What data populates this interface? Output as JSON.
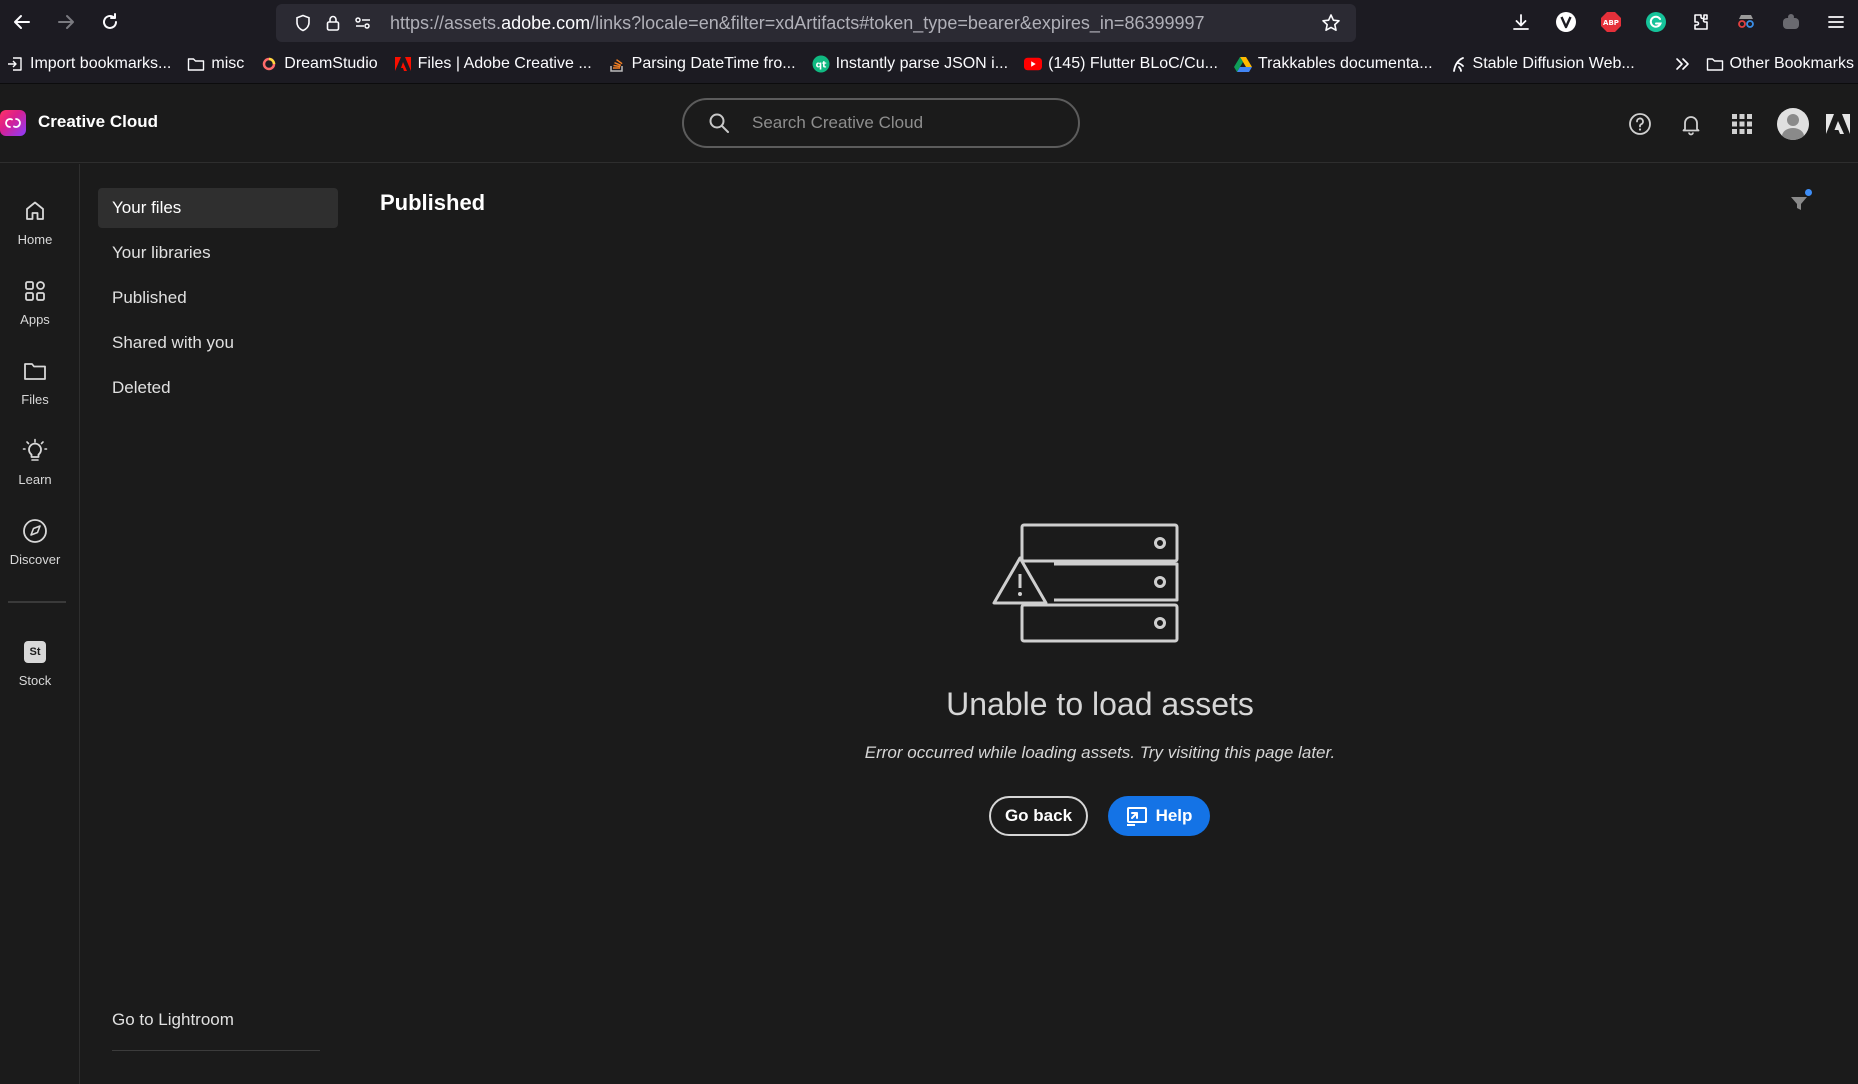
{
  "browser": {
    "url_prefix": "https://assets.",
    "url_host": "adobe.com",
    "url_rest": "/links?locale=en&filter=xdArtifacts#token_type=bearer&expires_in=86399997",
    "bookmarks": [
      {
        "label": "Import bookmarks...",
        "icon": "import-icon"
      },
      {
        "label": "misc",
        "icon": "folder-icon"
      },
      {
        "label": "DreamStudio",
        "icon": "dreamstudio-icon"
      },
      {
        "label": "Files | Adobe Creative ...",
        "icon": "adobe-icon"
      },
      {
        "label": "Parsing DateTime fro...",
        "icon": "stackoverflow-icon"
      },
      {
        "label": "Instantly parse JSON i...",
        "icon": "quicktype-icon"
      },
      {
        "label": "(145) Flutter BLoC/Cu...",
        "icon": "youtube-icon"
      },
      {
        "label": "Trakkables documenta...",
        "icon": "drive-icon"
      },
      {
        "label": "Stable Diffusion Web...",
        "icon": "huggingface-icon"
      }
    ],
    "other_bookmarks": "Other Bookmarks"
  },
  "header": {
    "title": "Creative Cloud",
    "search_placeholder": "Search Creative Cloud"
  },
  "rail": {
    "items": [
      {
        "label": "Home",
        "icon": "home-icon"
      },
      {
        "label": "Apps",
        "icon": "apps-icon"
      },
      {
        "label": "Files",
        "icon": "folder-icon"
      },
      {
        "label": "Learn",
        "icon": "lightbulb-icon"
      },
      {
        "label": "Discover",
        "icon": "compass-icon"
      },
      {
        "label": "Stock",
        "icon": "stock-icon"
      }
    ],
    "stock_badge": "St"
  },
  "files_nav": {
    "items": [
      {
        "label": "Your files",
        "active": true
      },
      {
        "label": "Your libraries",
        "active": false
      },
      {
        "label": "Published",
        "active": false
      },
      {
        "label": "Shared with you",
        "active": false
      },
      {
        "label": "Deleted",
        "active": false
      }
    ],
    "lightroom": "Go to Lightroom"
  },
  "main": {
    "title": "Published",
    "error_title": "Unable to load assets",
    "error_desc": "Error occurred while loading assets. Try visiting this page later.",
    "go_back": "Go back",
    "help": "Help"
  },
  "colors": {
    "accent": "#1473e6",
    "background": "#1b1b1b",
    "filter_dot": "#3e8ef7"
  }
}
